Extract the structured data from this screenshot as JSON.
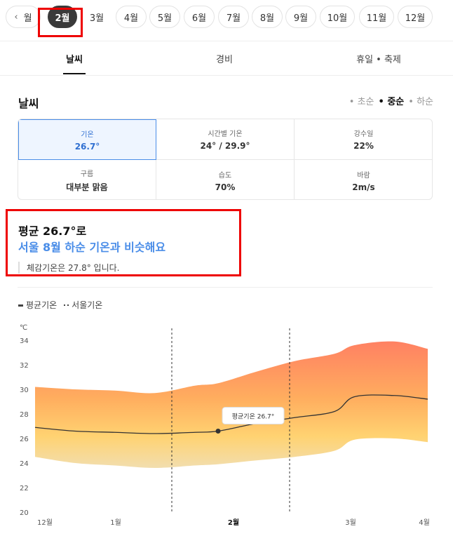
{
  "months": {
    "partial_label": "월",
    "items": [
      "2월",
      "3월",
      "4월",
      "5월",
      "6월",
      "7월",
      "8월",
      "9월",
      "10월",
      "11월",
      "12월"
    ],
    "selected": "2월"
  },
  "tabs": [
    {
      "label": "날씨",
      "active": true
    },
    {
      "label": "경비",
      "active": false
    },
    {
      "label": "휴일 • 축제",
      "active": false
    }
  ],
  "weather": {
    "title": "날씨",
    "seasons": [
      {
        "label": "• 초순",
        "active": false
      },
      {
        "label": "• 중순",
        "active": true
      },
      {
        "label": "• 하순",
        "active": false
      }
    ],
    "cells": [
      {
        "label": "기온",
        "value": "26.7°",
        "selected": true
      },
      {
        "label": "시간별 기온",
        "value": "24° / 29.9°",
        "selected": false
      },
      {
        "label": "강수일",
        "value": "22%",
        "selected": false
      },
      {
        "label": "구름",
        "value": "대부분 맑음",
        "selected": false
      },
      {
        "label": "습도",
        "value": "70%",
        "selected": false
      },
      {
        "label": "바람",
        "value": "2m/s",
        "selected": false
      }
    ],
    "summary": {
      "avg": "평균 26.7°로",
      "desc": "서울 8월 하순 기온과 비슷해요",
      "feel": "체감기온은 27.8° 입니다."
    }
  },
  "legend": {
    "avg": "평균기온",
    "seoul": "서울기온"
  },
  "chart_data": {
    "type": "area",
    "unit": "℃",
    "ylim": [
      20,
      35
    ],
    "yticks": [
      20,
      22,
      24,
      26,
      28,
      30,
      32,
      34
    ],
    "xticks": [
      "12월",
      "1월",
      "2월",
      "3월",
      "4월"
    ],
    "x": [
      0,
      0.6,
      1.2,
      1.8,
      2.4,
      2.75,
      3.3,
      3.9,
      4.5,
      4.8,
      5.4,
      5.9
    ],
    "avg": [
      26.9,
      26.6,
      26.5,
      26.4,
      26.5,
      26.6,
      27.2,
      27.7,
      28.2,
      29.4,
      29.5,
      29.2
    ],
    "upper": [
      30.2,
      30.0,
      29.9,
      29.7,
      30.3,
      30.5,
      31.4,
      32.3,
      32.9,
      33.6,
      33.9,
      33.3
    ],
    "lower": [
      24.5,
      24.0,
      23.8,
      23.6,
      23.8,
      23.9,
      24.2,
      24.5,
      25.0,
      25.9,
      26.0,
      25.7
    ],
    "marker": {
      "x": 2.75,
      "value": 26.6
    },
    "tooltip": "평균기온 26.7°"
  },
  "colors": {
    "accent": "#4a8de8",
    "highlight": "#e00000"
  }
}
